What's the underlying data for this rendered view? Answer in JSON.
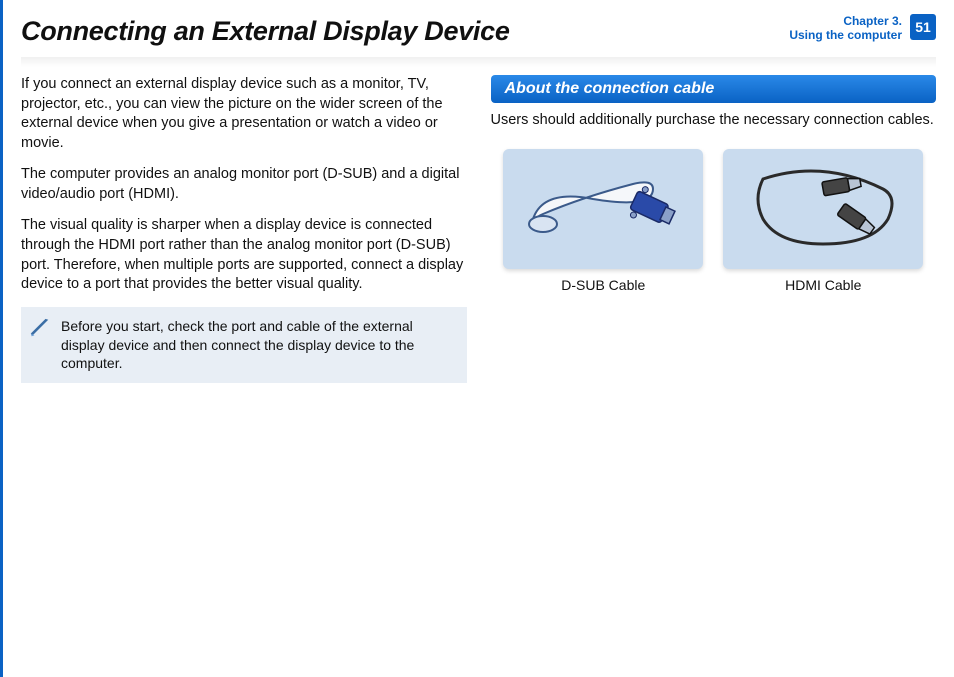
{
  "header": {
    "title": "Connecting an External Display Device",
    "chapter_line1": "Chapter 3.",
    "chapter_line2": "Using the computer",
    "page_number": "51"
  },
  "left": {
    "p1": "If you connect an external display device such as a monitor, TV, projector, etc., you can view the picture on the wider screen of the external device when you give a presentation or watch a video or movie.",
    "p2": "The computer provides an analog monitor port (D-SUB) and a digital video/audio port (HDMI).",
    "p3": "The visual quality is sharper when a display device is connected through the HDMI port rather than the analog monitor port (D-SUB) port. Therefore, when multiple ports are supported, connect a display device to a port that provides the better visual quality.",
    "note": "Before you start, check the port and cable of the external display device and then connect the display device to the computer."
  },
  "right": {
    "subheader": "About the connection cable",
    "intro": "Users should additionally purchase the necessary connection cables.",
    "cables": [
      {
        "caption": "D-SUB Cable"
      },
      {
        "caption": "HDMI Cable"
      }
    ]
  }
}
